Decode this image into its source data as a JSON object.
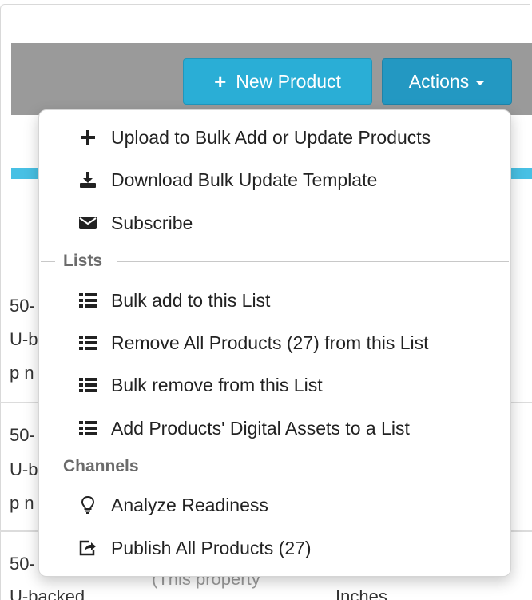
{
  "toolbar": {
    "new_product_label": "New Product",
    "actions_label": "Actions"
  },
  "background_rows": [
    [
      "50-",
      "U-b",
      "p n"
    ],
    [
      "50-",
      "U-b",
      "p n"
    ],
    [
      "50-",
      "U-backed",
      "(This property",
      "Inches"
    ]
  ],
  "menu": {
    "items": [
      {
        "label": "Upload to Bulk Add or Update Products",
        "icon": "plus-icon"
      },
      {
        "label": "Download Bulk Update Template",
        "icon": "download-icon"
      },
      {
        "label": "Subscribe",
        "icon": "envelope-icon"
      }
    ],
    "lists_header": "Lists",
    "list_items": [
      {
        "label": "Bulk add to this List",
        "icon": "list-icon"
      },
      {
        "label": "Remove All Products (27) from this List",
        "icon": "list-icon"
      },
      {
        "label": "Bulk remove from this List",
        "icon": "list-icon"
      },
      {
        "label": "Add Products' Digital Assets to a List",
        "icon": "list-icon"
      }
    ],
    "channels_header": "Channels",
    "channel_items": [
      {
        "label": "Analyze Readiness",
        "icon": "lightbulb-icon"
      },
      {
        "label": "Publish All Products (27)",
        "icon": "share-icon"
      }
    ]
  },
  "colors": {
    "primary_button": "#2aaed6",
    "actions_button": "#2398c2",
    "toolbar_bg": "#9a9a9a",
    "accent_strip": "#48c0e4"
  }
}
